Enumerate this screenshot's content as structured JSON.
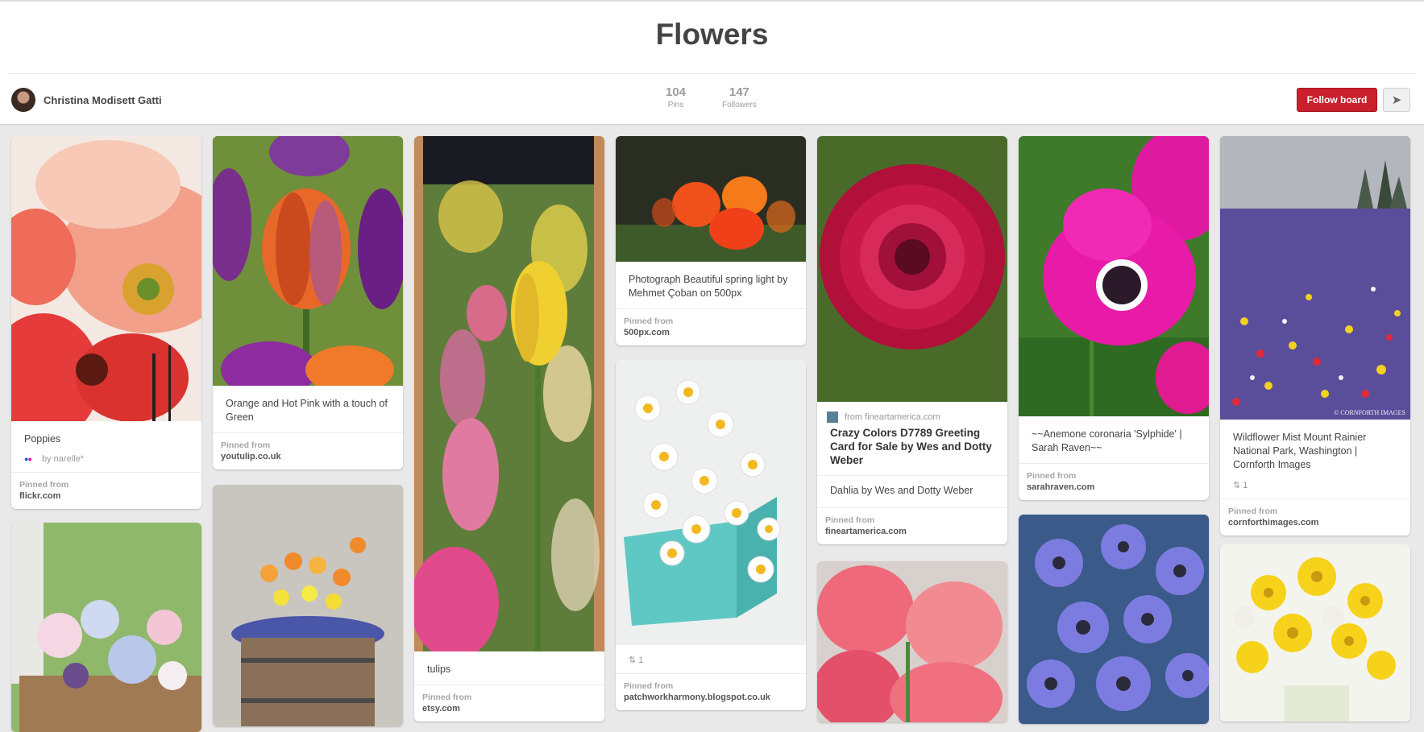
{
  "board": {
    "title": "Flowers",
    "owner": "Christina Modisett Gatti",
    "pins_count": "104",
    "pins_label": "Pins",
    "followers_count": "147",
    "followers_label": "Followers",
    "follow_label": "Follow board",
    "send_icon": "paper-plane-icon"
  },
  "common": {
    "pinned_from": "Pinned from"
  },
  "pins": [
    {
      "desc": "Poppies",
      "by": "by narelle*",
      "site": "flickr.com"
    },
    {
      "desc": "Orange and Hot Pink with a touch of Green",
      "site": "youtulip.co.uk"
    },
    {
      "desc": "tulips",
      "site": "etsy.com"
    },
    {
      "desc": "Photograph Beautiful spring light by Mehmet Çoban on 500px",
      "site": "500px.com"
    },
    {
      "repins": "1",
      "site": "patchworkharmony.blogspot.co.uk"
    },
    {
      "from": "from fineartamerica.com",
      "title": "Crazy Colors D7789 Greeting Card for Sale by Wes and Dotty Weber",
      "desc": "Dahlia by Wes and Dotty Weber",
      "site": "fineartamerica.com"
    },
    {
      "desc": "~~Anemone coronaria 'Sylphide' | Sarah Raven~~",
      "site": "sarahraven.com"
    },
    {
      "desc": "Wildflower Mist Mount Rainier National Park, Washington | Cornforth Images",
      "repins": "1",
      "site": "cornforthimages.com"
    }
  ],
  "image_watermark": "© CORNFORTH IMAGES",
  "colors": {
    "follow_button": "#c9202c",
    "background": "#e9e9e9"
  }
}
